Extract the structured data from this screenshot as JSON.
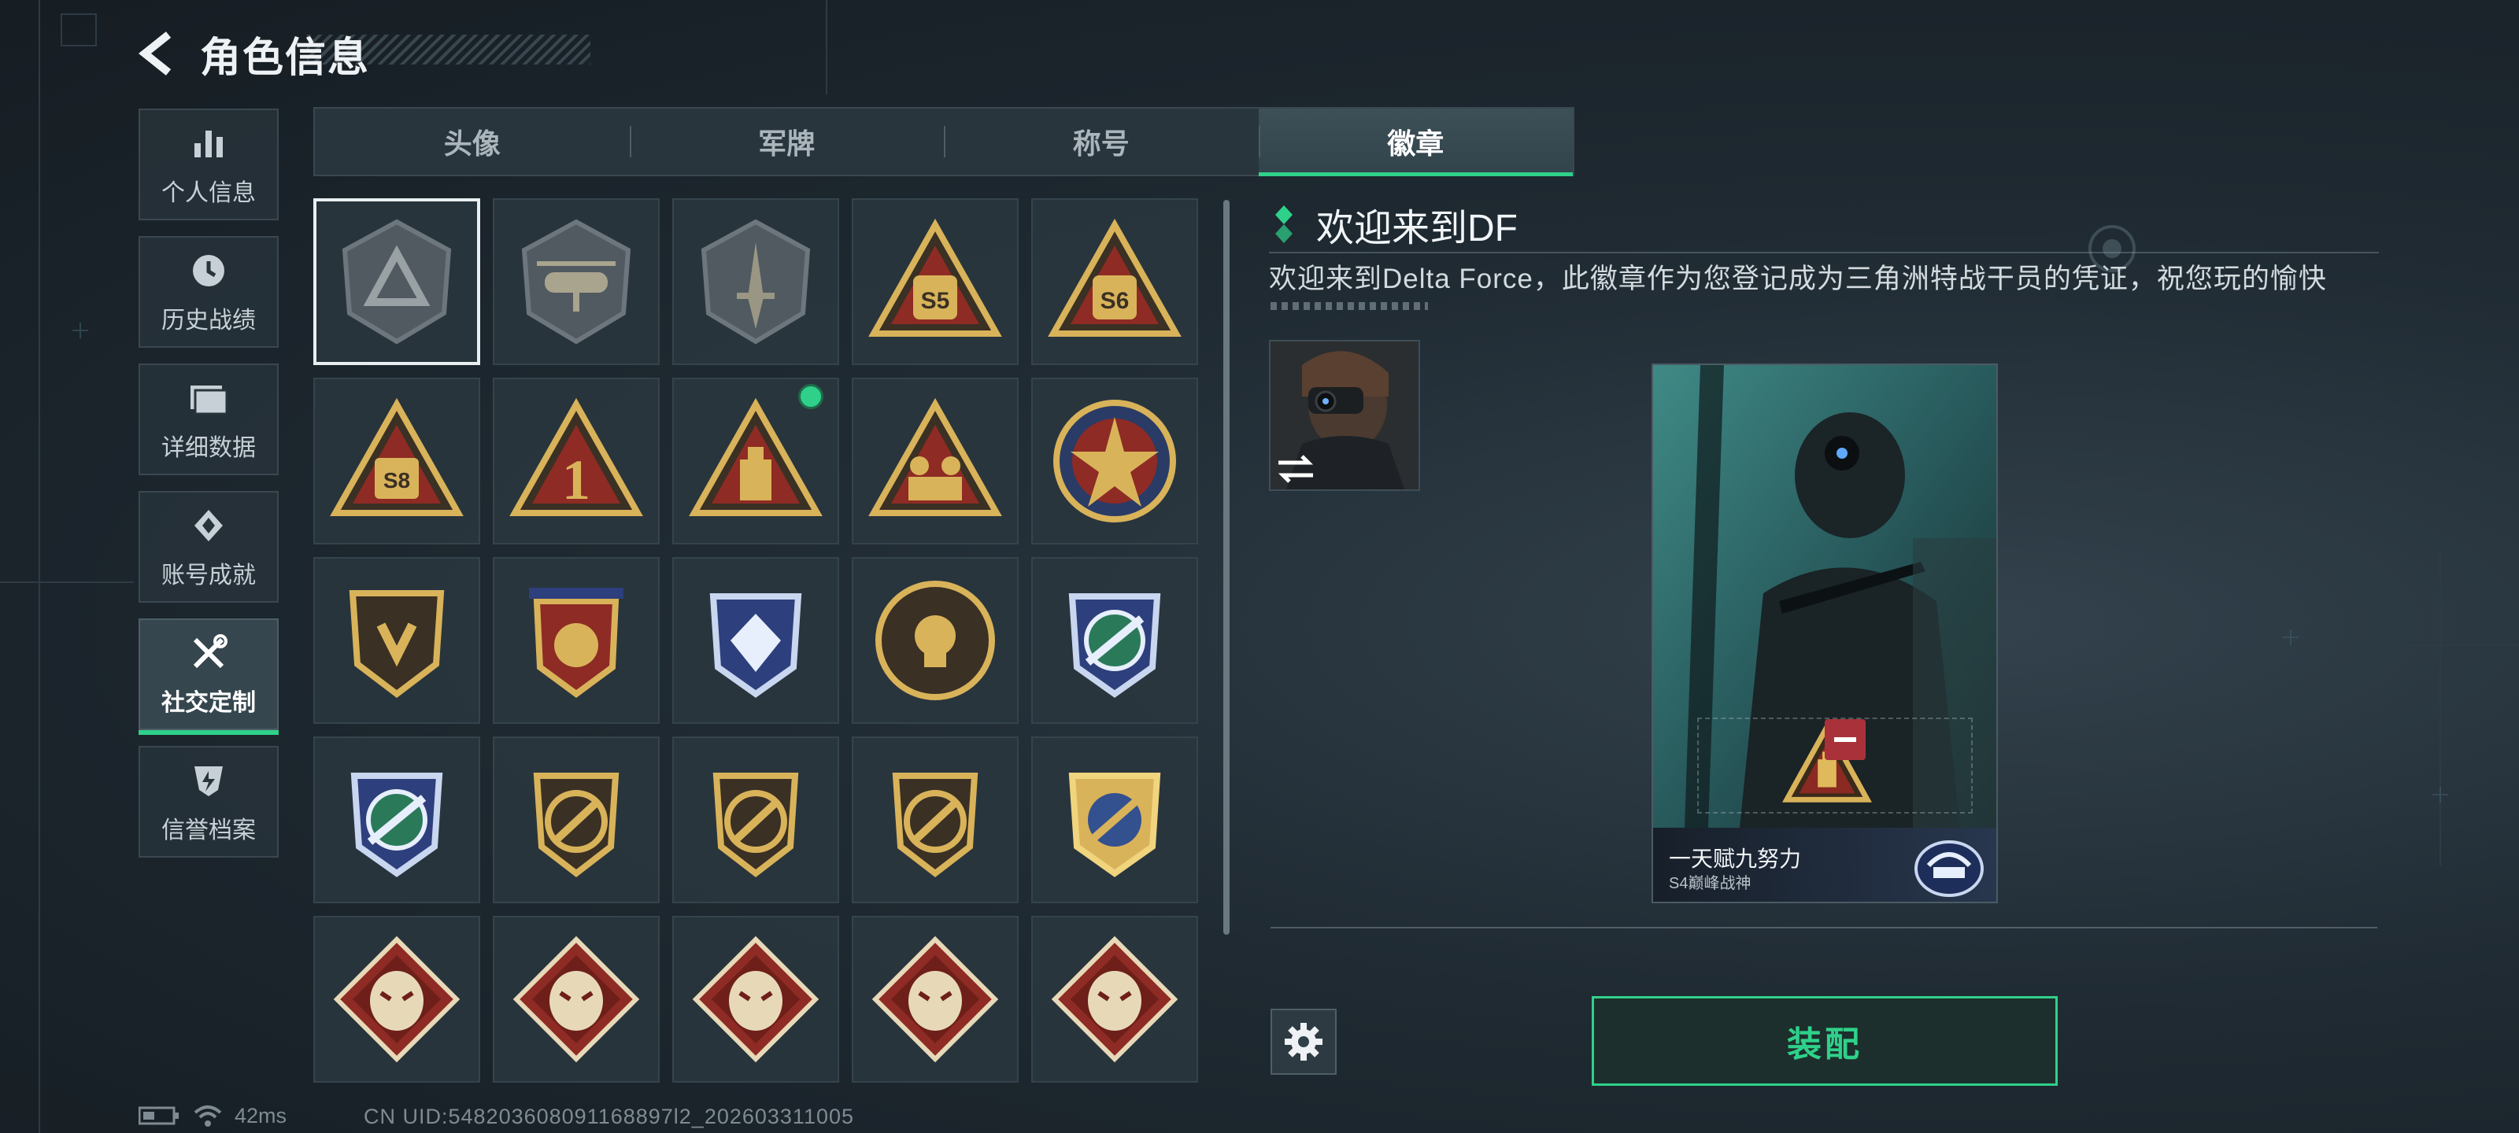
{
  "header": {
    "title": "角色信息"
  },
  "sidebar": {
    "items": [
      {
        "label": "个人信息",
        "icon": "bar-chart-icon"
      },
      {
        "label": "历史战绩",
        "icon": "clock-icon"
      },
      {
        "label": "详细数据",
        "icon": "folder-icon"
      },
      {
        "label": "账号成就",
        "icon": "achievement-icon"
      },
      {
        "label": "社交定制",
        "icon": "tools-icon",
        "active": true
      },
      {
        "label": "信誉档案",
        "icon": "shield-credit-icon"
      }
    ]
  },
  "tabs": [
    {
      "label": "头像"
    },
    {
      "label": "军牌"
    },
    {
      "label": "称号"
    },
    {
      "label": "徽章",
      "active": true
    }
  ],
  "badges": {
    "selected_index": 0,
    "new_indicator_index": 7,
    "items": [
      {
        "icon": "delta-shield-badge-icon"
      },
      {
        "icon": "helicopter-badge-icon"
      },
      {
        "icon": "dagger-shield-badge-icon"
      },
      {
        "icon": "s5-triangle-badge-icon"
      },
      {
        "icon": "s6-triangle-badge-icon"
      },
      {
        "icon": "s8-triangle-badge-icon"
      },
      {
        "icon": "number-one-triangle-badge-icon"
      },
      {
        "icon": "usb-triangle-badge-icon"
      },
      {
        "icon": "soldiers-triangle-badge-icon"
      },
      {
        "icon": "star-round-badge-icon"
      },
      {
        "icon": "wing-shield-badge-icon"
      },
      {
        "icon": "laurel-shield-badge-icon"
      },
      {
        "icon": "gem-shield-badge-icon"
      },
      {
        "icon": "skull-round-badge-icon"
      },
      {
        "icon": "rifle-crosshair-badge-icon"
      },
      {
        "icon": "rifle-crosshair-blue-badge-icon"
      },
      {
        "icon": "rifle-circle-badge-icon"
      },
      {
        "icon": "sniper-circle-badge-icon"
      },
      {
        "icon": "pistol-circle-badge-icon"
      },
      {
        "icon": "knife-crosshair-gold-badge-icon"
      },
      {
        "icon": "wolf-diamond-badge-icon"
      },
      {
        "icon": "wolf-diamond-badge-2-icon"
      },
      {
        "icon": "raptor-diamond-badge-icon"
      },
      {
        "icon": "dragon-diamond-badge-icon"
      },
      {
        "icon": "dragon-diamond-badge-2-icon"
      }
    ]
  },
  "detail": {
    "name": "欢迎来到DF",
    "description": "欢迎来到Delta Force，此徽章作为您登记成为三角洲特战干员的凭证，祝您玩的愉快"
  },
  "card": {
    "player_name": "一天赋九努力",
    "season_title": "S4巅峰战神"
  },
  "actions": {
    "equip_label": "装配"
  },
  "status": {
    "ping": "42ms",
    "uid": "CN UID:548203608091168897l2_202603311005"
  },
  "colors": {
    "accent": "#2fd18a",
    "remove": "#a9323a"
  }
}
